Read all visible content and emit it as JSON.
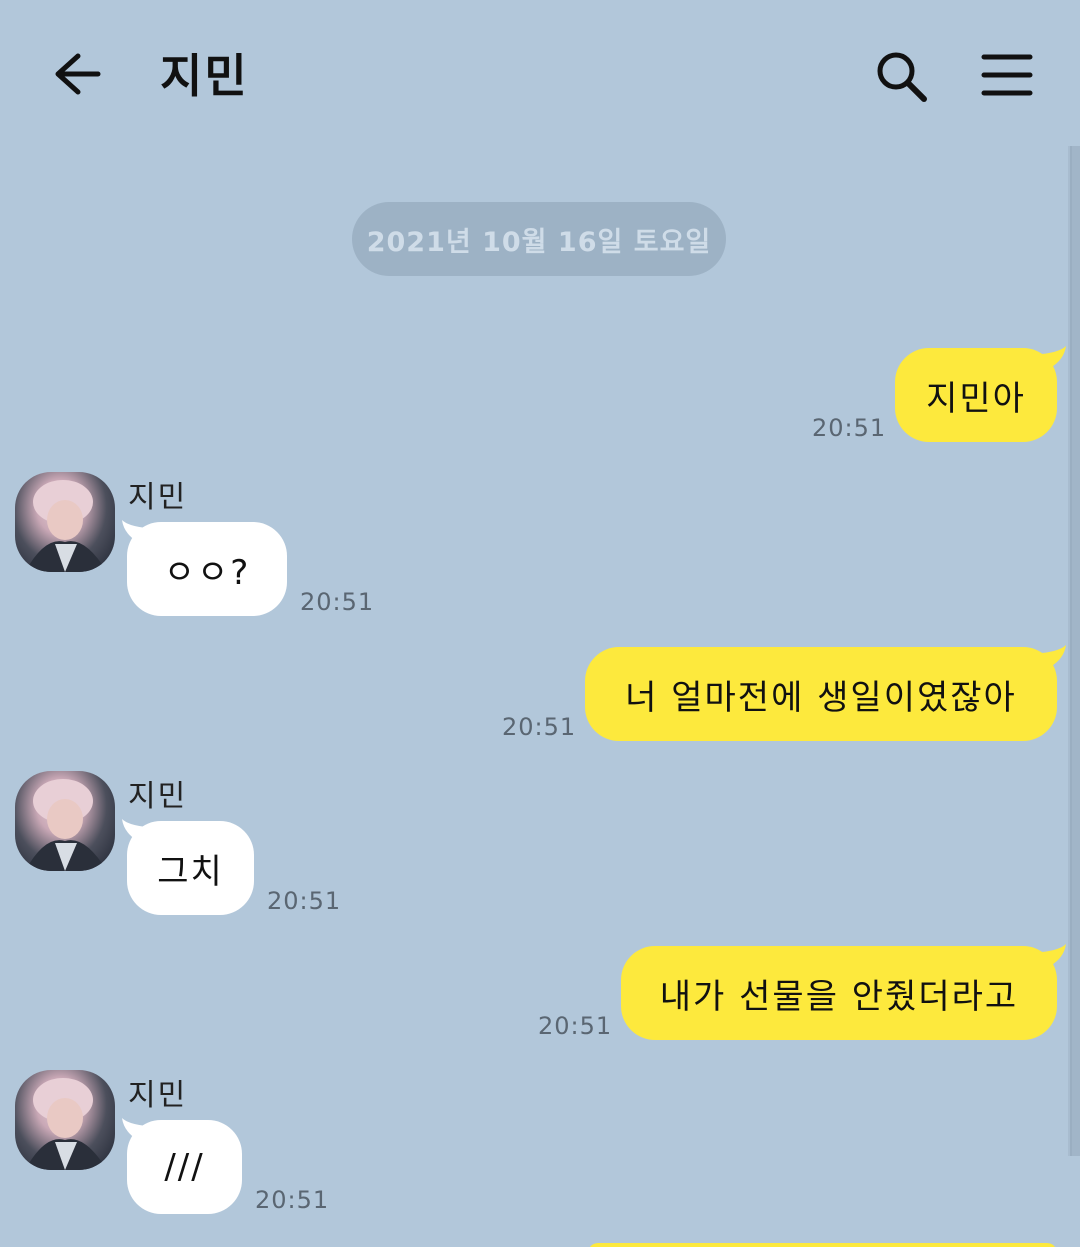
{
  "header": {
    "title": "지민",
    "back_icon": "arrow-left-icon",
    "search_icon": "search-icon",
    "menu_icon": "hamburger-menu-icon"
  },
  "date_divider": "2021년 10월 16일 토요일",
  "messages": [
    {
      "direction": "out",
      "text": "지민아",
      "time": "20:51"
    },
    {
      "direction": "in",
      "sender": "지민",
      "text": "ㅇㅇ?",
      "time": "20:51"
    },
    {
      "direction": "out",
      "text": "너 얼마전에 생일이였잖아",
      "time": "20:51"
    },
    {
      "direction": "in",
      "sender": "지민",
      "text": "그치",
      "time": "20:51"
    },
    {
      "direction": "out",
      "text": "내가 선물을 안줬더라고",
      "time": "20:51"
    },
    {
      "direction": "in",
      "sender": "지민",
      "text": "///",
      "time": "20:51"
    }
  ],
  "colors": {
    "background": "#b2c7da",
    "outgoing_bubble": "#fde93d",
    "incoming_bubble": "#ffffff",
    "date_pill": "#9db2c5"
  }
}
